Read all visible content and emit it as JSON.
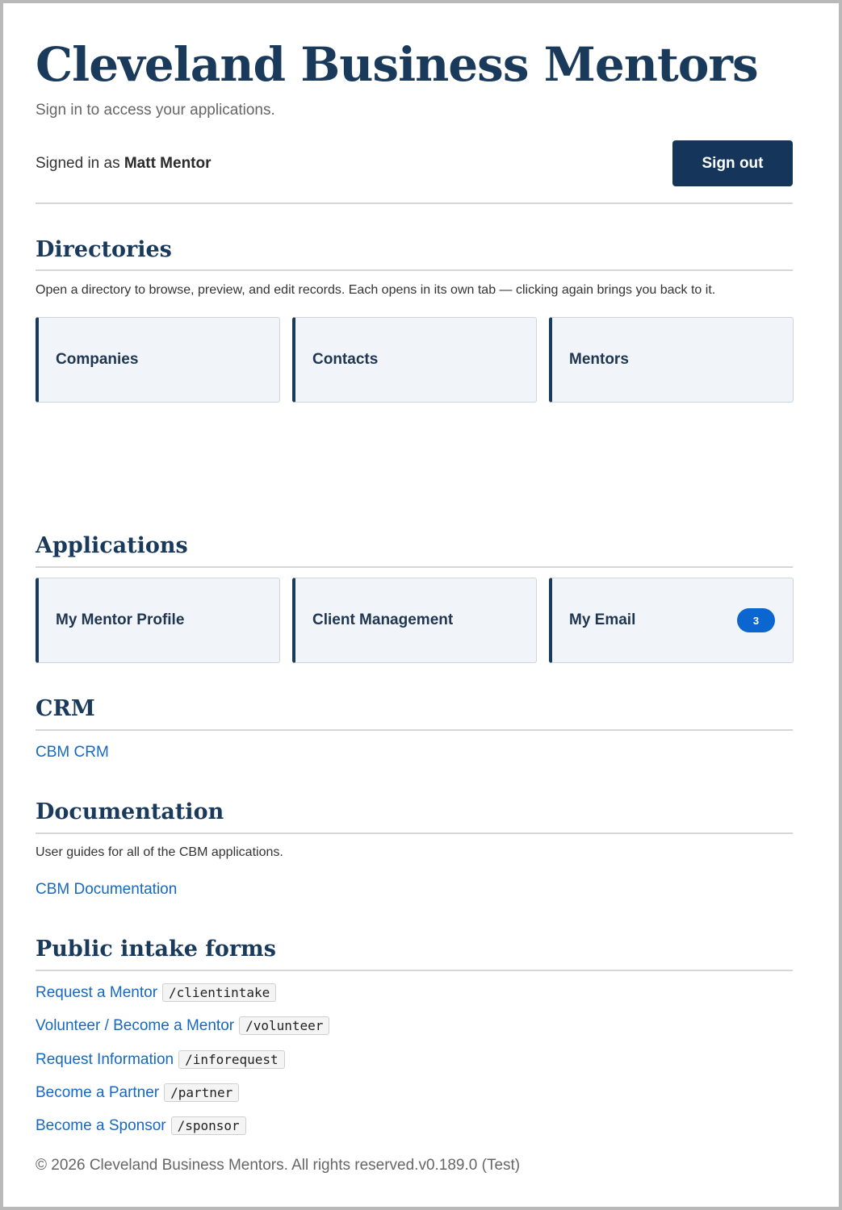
{
  "header": {
    "title": "Cleveland Business Mentors",
    "subtitle": "Sign in to access your applications.",
    "signed_in_prefix": "Signed in as ",
    "user_name": "Matt Mentor",
    "sign_out_label": "Sign out"
  },
  "directories": {
    "title": "Directories",
    "description": "Open a directory to browse, preview, and edit records. Each opens in its own tab — clicking again brings you back to it.",
    "cards": [
      {
        "label": "Companies"
      },
      {
        "label": "Contacts"
      },
      {
        "label": "Mentors"
      }
    ]
  },
  "applications": {
    "title": "Applications",
    "cards": [
      {
        "label": "My Mentor Profile"
      },
      {
        "label": "Client Management"
      },
      {
        "label": "My Email",
        "badge": "3"
      }
    ]
  },
  "crm": {
    "title": "CRM",
    "link": "CBM CRM"
  },
  "documentation": {
    "title": "Documentation",
    "description": "User guides for all of the CBM applications.",
    "link": "CBM Documentation"
  },
  "public_forms": {
    "title": "Public intake forms",
    "items": [
      {
        "label": "Request a Mentor",
        "path": "/clientintake"
      },
      {
        "label": "Volunteer / Become a Mentor",
        "path": "/volunteer"
      },
      {
        "label": "Request Information",
        "path": "/inforequest"
      },
      {
        "label": "Become a Partner",
        "path": "/partner"
      },
      {
        "label": "Become a Sponsor",
        "path": "/sponsor"
      }
    ]
  },
  "footer": {
    "text": "© 2026 Cleveland Business Mentors. All rights reserved.v0.189.0 (Test)"
  },
  "colors": {
    "brand_navy": "#1a3a5c",
    "button_navy": "#15365a",
    "link_blue": "#1668c2",
    "badge_blue": "#0b66d0"
  }
}
